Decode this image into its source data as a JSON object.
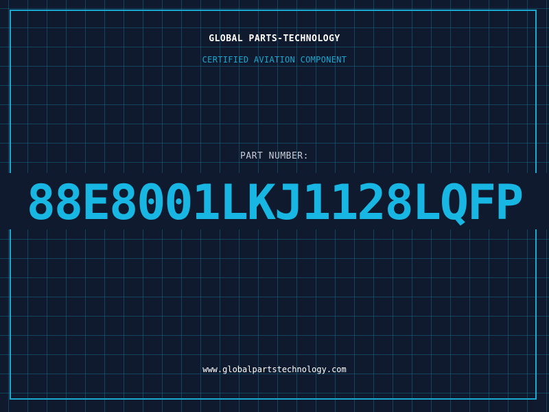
{
  "header": {
    "company": "GLOBAL PARTS-TECHNOLOGY",
    "subtitle": "CERTIFIED AVIATION COMPONENT"
  },
  "part": {
    "label": "PART NUMBER:",
    "value": "88E8001LKJ1128LQFP"
  },
  "footer": {
    "website": "www.globalpartstechnology.com"
  },
  "colors": {
    "background": "#0f1a2e",
    "accent": "#18b6e2",
    "frame": "#1aa7d0",
    "text": "#ffffff"
  }
}
